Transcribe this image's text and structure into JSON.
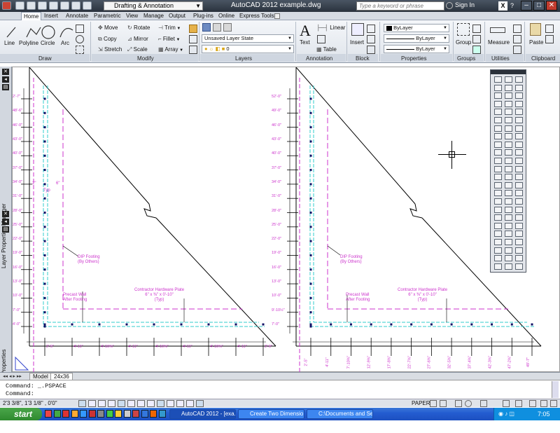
{
  "titlebar": {
    "workspace": "Drafting & Annotation",
    "app_title": "AutoCAD 2012    example.dwg",
    "search_placeholder": "Type a keyword or phrase",
    "signin": "Sign In"
  },
  "tabs": [
    "Home",
    "Insert",
    "Annotate",
    "Parametric",
    "View",
    "Manage",
    "Output",
    "Plug-ins",
    "Online",
    "Express Tools"
  ],
  "ribbon": {
    "draw": {
      "label": "Draw",
      "tools": [
        "Line",
        "Polyline",
        "Circle",
        "Arc"
      ]
    },
    "modify": {
      "label": "Modify",
      "tools": [
        "Move",
        "Rotate",
        "Trim",
        "Copy",
        "Mirror",
        "Fillet",
        "Stretch",
        "Scale",
        "Array"
      ]
    },
    "layers": {
      "label": "Layers",
      "state": "Unsaved Layer State",
      "current": "0"
    },
    "annotation": {
      "label": "Annotation",
      "tools": [
        "Text",
        "Linear",
        "Table"
      ]
    },
    "block": {
      "label": "Block",
      "tools": [
        "Insert"
      ]
    },
    "properties": {
      "label": "Properties",
      "color": "ByLayer",
      "linetype": "ByLayer",
      "lineweight": "ByLayer"
    },
    "groups": {
      "label": "Groups",
      "tools": [
        "Group"
      ]
    },
    "utilities": {
      "label": "Utilities",
      "tools": [
        "Measure"
      ]
    },
    "clipboard": {
      "label": "Clipboard",
      "tools": [
        "Paste"
      ]
    }
  },
  "palettes": {
    "layer_manager": "Layer Properties Manager",
    "properties": "Properties"
  },
  "drawing": {
    "left": {
      "dims_vertical": [
        "2'-7\"",
        "48'-6\"",
        "46'-0\"",
        "43'-0\"",
        "40'-0\"",
        "37'-0\"",
        "34'-0\"",
        "31'-0\"",
        "28'-0\"",
        "25'-0\"",
        "22'-0\"",
        "19'-0\"",
        "16'-0\"",
        "13'-0\"",
        "10'-0\"",
        "7'-0\"",
        "4'-0\""
      ],
      "dims_horizontal": [
        "2'-5\"",
        "4'-11\"",
        "4'-10⅜\"",
        "4'-11\"",
        "4'-10⅜\"",
        "4'-11\"",
        "4'-10⅜\"",
        "4'-11\"",
        "2'-5\""
      ],
      "note_dim1": "2\"",
      "note_dim2": "6\"",
      "note_typ": "Typ",
      "note_footing": "DIP Footing\n(By Others)",
      "note_precast": "Precast Wall\nAfter Footing",
      "note_hardware": "Contractor Hardware Plate\n6\" x ⅜\" x 0'-10\"\n(Typ)"
    },
    "right": {
      "dims_vertical": [
        "52'-0\"",
        "49'-0\"",
        "46'-0\"",
        "43'-0\"",
        "40'-0\"",
        "37'-0\"",
        "34'-0\"",
        "31'-0\"",
        "28'-0\"",
        "25'-0\"",
        "22'-0\"",
        "19'-0\"",
        "16'-0\"",
        "13'-0\"",
        "10'-0\"",
        "9'-10½\"",
        "7'-0\""
      ],
      "dims_horizontal": [
        "2'-5\"",
        "4'-11\"",
        "7'-10⅜\"",
        "12'-9⅜\"",
        "17'-8⅜\"",
        "22'-7⅜\"",
        "27'-6⅜\"",
        "32'-5⅜\"",
        "37'-4⅜\"",
        "42'-3⅜\"",
        "47'-2⅜\"",
        "49'-7\""
      ],
      "note_footing": "DIP Footing\n(By Others)",
      "note_precast": "Precast Wall\nAfter Footing",
      "note_hardware": "Contractor Hardware Plate\n6\" x ⅜\" x 0'-10\"\n(Typ)"
    }
  },
  "layout_tabs": [
    "Model",
    "24x36"
  ],
  "command": {
    "line1": "Command:  _.PSPACE",
    "line2": "Command:"
  },
  "status": {
    "coords": "2'3 3/8\",  1'3 1/8\"  , 0'0\"",
    "space": "PAPER"
  },
  "taskbar": {
    "start": "start",
    "tasks": [
      "AutoCAD 2012 - [exa...",
      "Create Two Dimensio...",
      "C:\\Documents and Se..."
    ],
    "clock": "7:05 PM"
  },
  "colors": {
    "magenta": "#cc33cc",
    "cyan": "#33cccc",
    "titlebar": "#2a323d",
    "taskbar": "#245dd1"
  }
}
